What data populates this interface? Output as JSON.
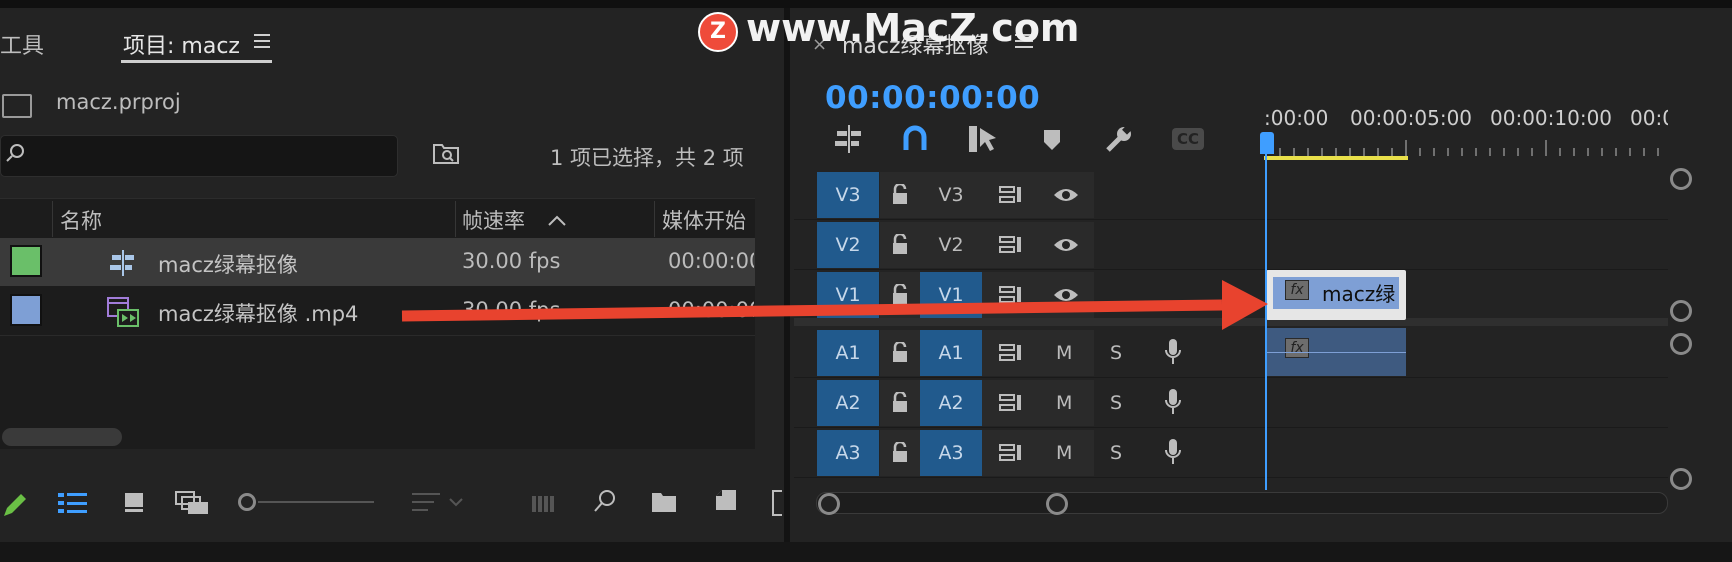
{
  "watermark": {
    "logo_letter": "Z",
    "text": "www.MacZ.com"
  },
  "project_panel": {
    "tab_tools": "工具",
    "tab_project": "项目: macz",
    "file_name": "macz.prproj",
    "search": {
      "value": "",
      "placeholder": ""
    },
    "selection_status": "1 项已选择，共 2 项",
    "columns": [
      "名称",
      "帧速率",
      "媒体开始"
    ],
    "items": [
      {
        "name": "macz绿幕抠像",
        "fps": "30.00 fps",
        "start": "00:00:00:",
        "color": "#6abf69",
        "icon": "sequence-icon",
        "selected": true
      },
      {
        "name": "macz绿幕抠像 .mp4",
        "fps": "30.00 fps",
        "start": "00:00:00:",
        "color": "#7e9fd5",
        "icon": "video-clip-icon",
        "selected": false
      }
    ]
  },
  "timeline": {
    "sequence_tab": "macz绿幕抠像",
    "close_glyph": "×",
    "timecode": "00:00:00:00",
    "ruler_labels": [
      ":00:00",
      "00:00:05:00",
      "00:00:10:00",
      "00:0"
    ],
    "video_tracks": [
      {
        "target": "V3",
        "source": "V3",
        "source_on": false
      },
      {
        "target": "V2",
        "source": "V2",
        "source_on": false
      },
      {
        "target": "V1",
        "source": "V1",
        "source_on": true
      }
    ],
    "audio_tracks": [
      {
        "target": "A1",
        "source": "A1",
        "mute": "M",
        "solo": "S"
      },
      {
        "target": "A2",
        "source": "A2",
        "mute": "M",
        "solo": "S"
      },
      {
        "target": "A3",
        "source": "A3",
        "mute": "M",
        "solo": "S"
      }
    ],
    "video_clip_label": "macz绿",
    "fx_label": "fx"
  },
  "colors": {
    "accent": "#3f9eff",
    "track_blue": "#215a8d",
    "arrow": "#e8432e",
    "work_area": "#e9e04a"
  }
}
